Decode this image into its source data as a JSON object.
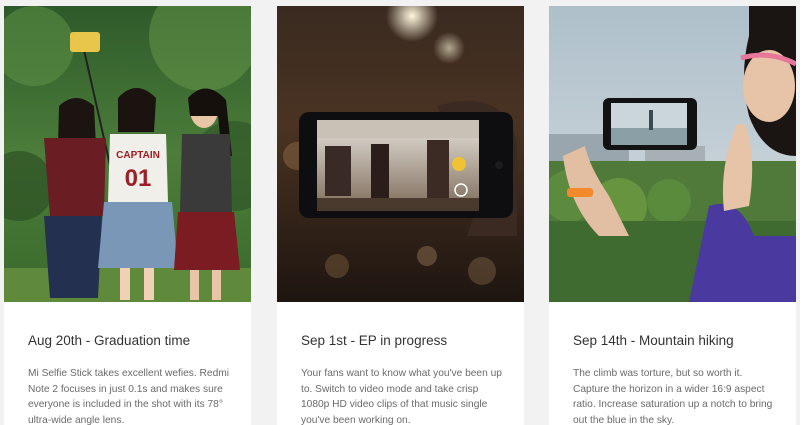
{
  "cards": [
    {
      "title": "Aug 20th - Graduation time",
      "body": "Mi Selfie Stick takes excellent wefies. Redmi Note 2 focuses in just 0.1s and makes sure everyone is included in the shot with its 78° ultra-wide angle lens.",
      "shirt_text_top": "CAPTAIN",
      "shirt_text_bottom": "01"
    },
    {
      "title": "Sep 1st - EP in progress",
      "body": "Your fans want to know what you've been up to. Switch to video mode and take crisp 1080p HD video clips of that music single you've been working on."
    },
    {
      "title": "Sep 14th - Mountain hiking",
      "body": "The climb was torture, but so worth it. Capture the horizon in a wider 16:9 aspect ratio. Increase saturation up a notch to bring out the blue in the sky."
    }
  ],
  "colors": {
    "page_bg": "#f2f2f2",
    "card_bg": "#ffffff",
    "title": "#333333",
    "body": "#6a6a6a"
  }
}
